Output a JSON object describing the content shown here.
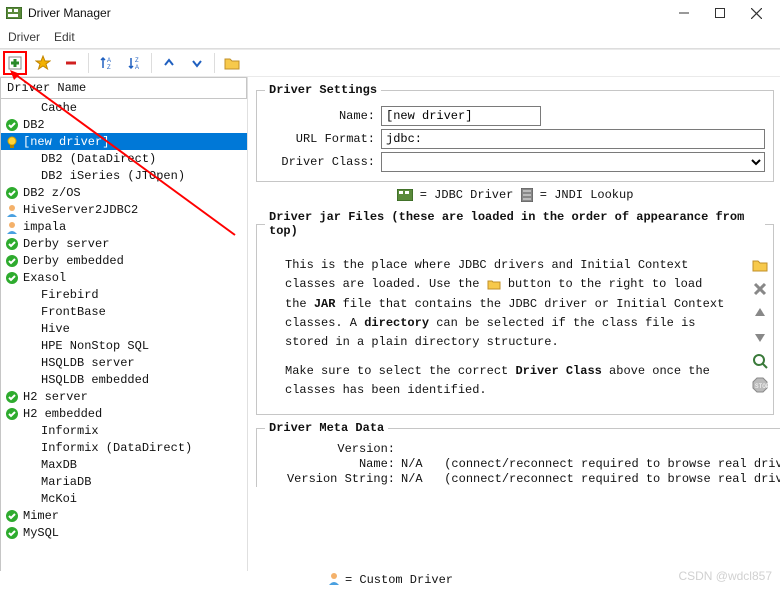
{
  "titlebar": {
    "title": "Driver Manager"
  },
  "menu": {
    "driver": "Driver",
    "edit": "Edit"
  },
  "list": {
    "header": "Driver Name",
    "items": [
      {
        "label": "Cache",
        "icon": "none",
        "sel": false
      },
      {
        "label": "DB2",
        "icon": "check",
        "sel": false
      },
      {
        "label": "[new driver]",
        "icon": "bulb",
        "sel": true
      },
      {
        "label": "DB2 (DataDirect)",
        "icon": "none",
        "sel": false
      },
      {
        "label": "DB2 iSeries (JTOpen)",
        "icon": "none",
        "sel": false
      },
      {
        "label": "DB2 z/OS",
        "icon": "check",
        "sel": false
      },
      {
        "label": "HiveServer2JDBC2",
        "icon": "user",
        "sel": false
      },
      {
        "label": "impala",
        "icon": "user",
        "sel": false
      },
      {
        "label": "Derby server",
        "icon": "check",
        "sel": false
      },
      {
        "label": "Derby embedded",
        "icon": "check",
        "sel": false
      },
      {
        "label": "Exasol",
        "icon": "check",
        "sel": false
      },
      {
        "label": "Firebird",
        "icon": "none",
        "sel": false
      },
      {
        "label": "FrontBase",
        "icon": "none",
        "sel": false
      },
      {
        "label": "Hive",
        "icon": "none",
        "sel": false
      },
      {
        "label": "HPE NonStop SQL",
        "icon": "none",
        "sel": false
      },
      {
        "label": "HSQLDB server",
        "icon": "none",
        "sel": false
      },
      {
        "label": "HSQLDB embedded",
        "icon": "none",
        "sel": false
      },
      {
        "label": "H2 server",
        "icon": "check",
        "sel": false
      },
      {
        "label": "H2 embedded",
        "icon": "check",
        "sel": false
      },
      {
        "label": "Informix",
        "icon": "none",
        "sel": false
      },
      {
        "label": "Informix (DataDirect)",
        "icon": "none",
        "sel": false
      },
      {
        "label": "MaxDB",
        "icon": "none",
        "sel": false
      },
      {
        "label": "MariaDB",
        "icon": "none",
        "sel": false
      },
      {
        "label": "McKoi",
        "icon": "none",
        "sel": false
      },
      {
        "label": "Mimer",
        "icon": "check",
        "sel": false
      },
      {
        "label": "MySQL",
        "icon": "check",
        "sel": false
      }
    ]
  },
  "settings": {
    "legend": "Driver Settings",
    "name_label": "Name:",
    "name_value": "[new driver]",
    "url_label": "URL Format:",
    "url_value": "jdbc:",
    "class_label": "Driver Class:",
    "class_value": ""
  },
  "legendline": {
    "jdbc": " = JDBC Driver ",
    "jndi": " = JNDI Lookup"
  },
  "jars": {
    "legend": "Driver jar Files (these are loaded in the order of appearance from top)",
    "help1a": "This is the place where JDBC drivers and Initial Context classes are loaded. Use the ",
    "help1b": " button to the right to load the ",
    "help1c": " file that contains the JDBC driver or Initial Context classes. A ",
    "help1d": " can be selected if the class file is stored in a plain directory structure.",
    "bold_jar": "JAR",
    "bold_dir": "directory",
    "help2a": "Make sure to select the correct ",
    "bold_dc": "Driver Class",
    "help2b": " above once the classes has been identified."
  },
  "metadata": {
    "legend": "Driver Meta Data",
    "version_label": "Version:",
    "version_value": "",
    "name_label": "Name:",
    "name_value": "N/A",
    "name_note": "(connect/reconnect required to browse real driver version)",
    "vstring_label": "Version String:",
    "vstring_value": "N/A",
    "vstring_note": "(connect/reconnect required to browse real driver version)"
  },
  "footer": {
    "legend": " = Custom Driver"
  },
  "watermark": "CSDN @wdcl857"
}
